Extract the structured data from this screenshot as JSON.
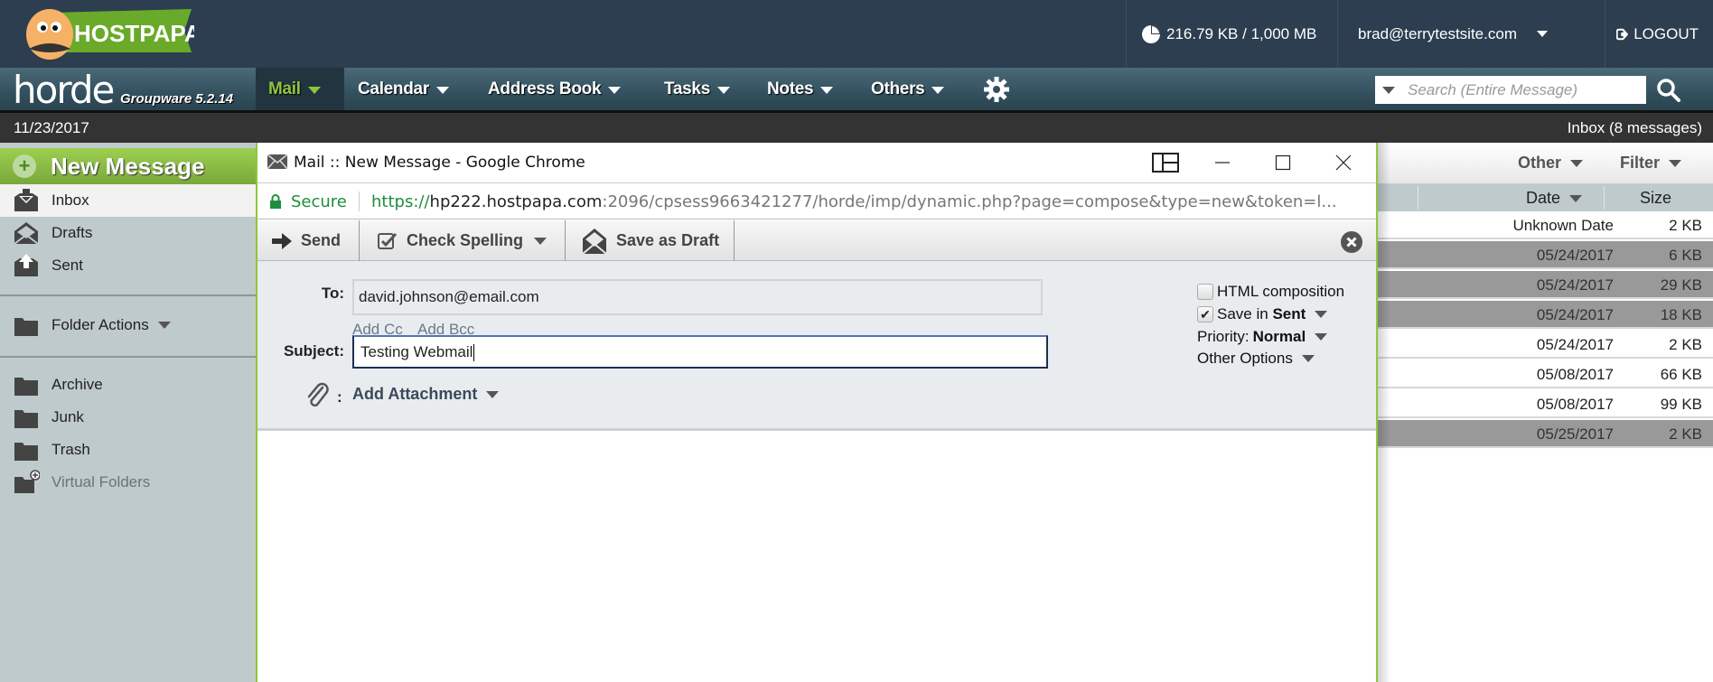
{
  "brand": {
    "name": "HOSTPAPA",
    "app": "horde",
    "version": "Groupware 5.2.14"
  },
  "topbar": {
    "quota": "216.79 KB / 1,000 MB",
    "user": "brad@terrytestsite.com",
    "logout": "LOGOUT"
  },
  "nav": {
    "items": [
      {
        "label": "Mail",
        "active": true
      },
      {
        "label": "Calendar"
      },
      {
        "label": "Address Book"
      },
      {
        "label": "Tasks"
      },
      {
        "label": "Notes"
      },
      {
        "label": "Others"
      }
    ],
    "search_placeholder": "Search (Entire Message)"
  },
  "datebar": {
    "date": "11/23/2017",
    "inbox_count": "Inbox (8 messages)"
  },
  "sidebar": {
    "new_message": "New Message",
    "folders": [
      {
        "label": "Inbox",
        "icon": "inbox-icon"
      },
      {
        "label": "Drafts",
        "icon": "drafts-icon"
      },
      {
        "label": "Sent",
        "icon": "sent-icon"
      }
    ],
    "folder_actions": "Folder Actions",
    "other_folders": [
      {
        "label": "Archive"
      },
      {
        "label": "Junk"
      },
      {
        "label": "Trash"
      },
      {
        "label": "Virtual Folders"
      }
    ]
  },
  "message_list": {
    "toolbar": {
      "other": "Other",
      "filter": "Filter"
    },
    "headers": {
      "date": "Date",
      "size": "Size"
    },
    "rows": [
      {
        "date": "Unknown Date",
        "size": "2 KB",
        "deleted": false
      },
      {
        "date": "05/24/2017",
        "size": "6 KB",
        "deleted": true
      },
      {
        "date": "05/24/2017",
        "size": "29 KB",
        "deleted": true
      },
      {
        "date": "05/24/2017",
        "size": "18 KB",
        "deleted": true
      },
      {
        "date": "05/24/2017",
        "size": "2 KB",
        "deleted": false
      },
      {
        "date": "05/08/2017",
        "size": "66 KB",
        "deleted": false
      },
      {
        "date": "05/08/2017",
        "size": "99 KB",
        "deleted": false
      },
      {
        "date": "05/25/2017",
        "size": "2 KB",
        "deleted": true
      }
    ]
  },
  "popup": {
    "window_title": "Mail :: New Message - Google Chrome",
    "secure_label": "Secure",
    "url_scheme": "https://",
    "url_host": "hp222.hostpapa.com",
    "url_rest": ":2096/cpsess9663421277/horde/imp/dynamic.php?page=compose&type=new&token=l...",
    "toolbar": {
      "send": "Send",
      "check_spelling": "Check Spelling",
      "save_draft": "Save as Draft"
    },
    "compose": {
      "to_label": "To:",
      "to_value": "david.johnson@email.com",
      "add_cc": "Add Cc",
      "add_bcc": "Add Bcc",
      "subject_label": "Subject:",
      "subject_value": "Testing Webmail",
      "attach_colon": ":",
      "add_attachment": "Add Attachment",
      "html_composition": "HTML composition",
      "html_checked": false,
      "save_in_prefix": "Save in ",
      "save_in_folder": "Sent",
      "save_checked": true,
      "priority_label": "Priority:",
      "priority_value": "Normal",
      "other_options": "Other Options"
    }
  },
  "colors": {
    "accent_green": "#8dc63f",
    "topbar": "#2c3e4f",
    "secure_green": "#1e8e3e"
  }
}
